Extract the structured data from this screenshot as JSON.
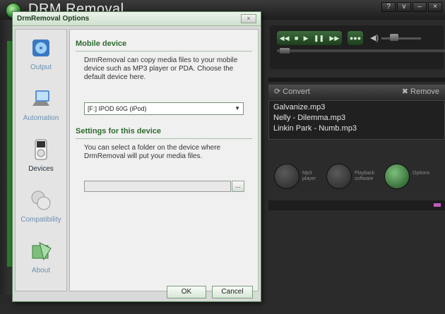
{
  "app": {
    "title": "DRM Removal",
    "window_buttons": [
      "?",
      "v",
      "–",
      "×"
    ]
  },
  "player": {
    "controls": [
      "◀◀",
      "■",
      "▶",
      "❚❚",
      "▶▶"
    ],
    "extra": "●●●",
    "volume_icon": "◀)"
  },
  "list": {
    "convert_label": "Convert",
    "remove_label": "Remove",
    "files": [
      "Galvanize.mp3",
      "Nelly - Dilemma.mp3",
      "Linkin Park - Numb.mp3"
    ]
  },
  "tools": [
    {
      "label": "Mp3\nplayer",
      "icon": "mp3-player-icon"
    },
    {
      "label": "Playback\nsoftware",
      "icon": "playback-software-icon"
    },
    {
      "label": "Options",
      "icon": "options-tools-icon"
    }
  ],
  "dialog": {
    "title": "DrmRemoval Options",
    "close": "×",
    "sidebar": [
      {
        "label": "Output",
        "icon": "output-icon"
      },
      {
        "label": "Automation",
        "icon": "automation-icon"
      },
      {
        "label": "Devices",
        "icon": "ipod-icon",
        "active": true
      },
      {
        "label": "Compatibility",
        "icon": "compatibility-icon"
      },
      {
        "label": "About",
        "icon": "about-icon"
      }
    ],
    "mobile_device_heading": "Mobile device",
    "mobile_device_desc": "DrmRemoval can copy media files to your mobile device such as MP3 player or PDA. Choose the default device here.",
    "device_select_value": "[F:] IPOD 60G (iPod)",
    "settings_heading": "Settings for this device",
    "settings_desc": "You can select a folder on the device where DrmRemoval will put your media files.",
    "folder_value": "",
    "browse_label": "...",
    "ok_label": "OK",
    "cancel_label": "Cancel"
  }
}
